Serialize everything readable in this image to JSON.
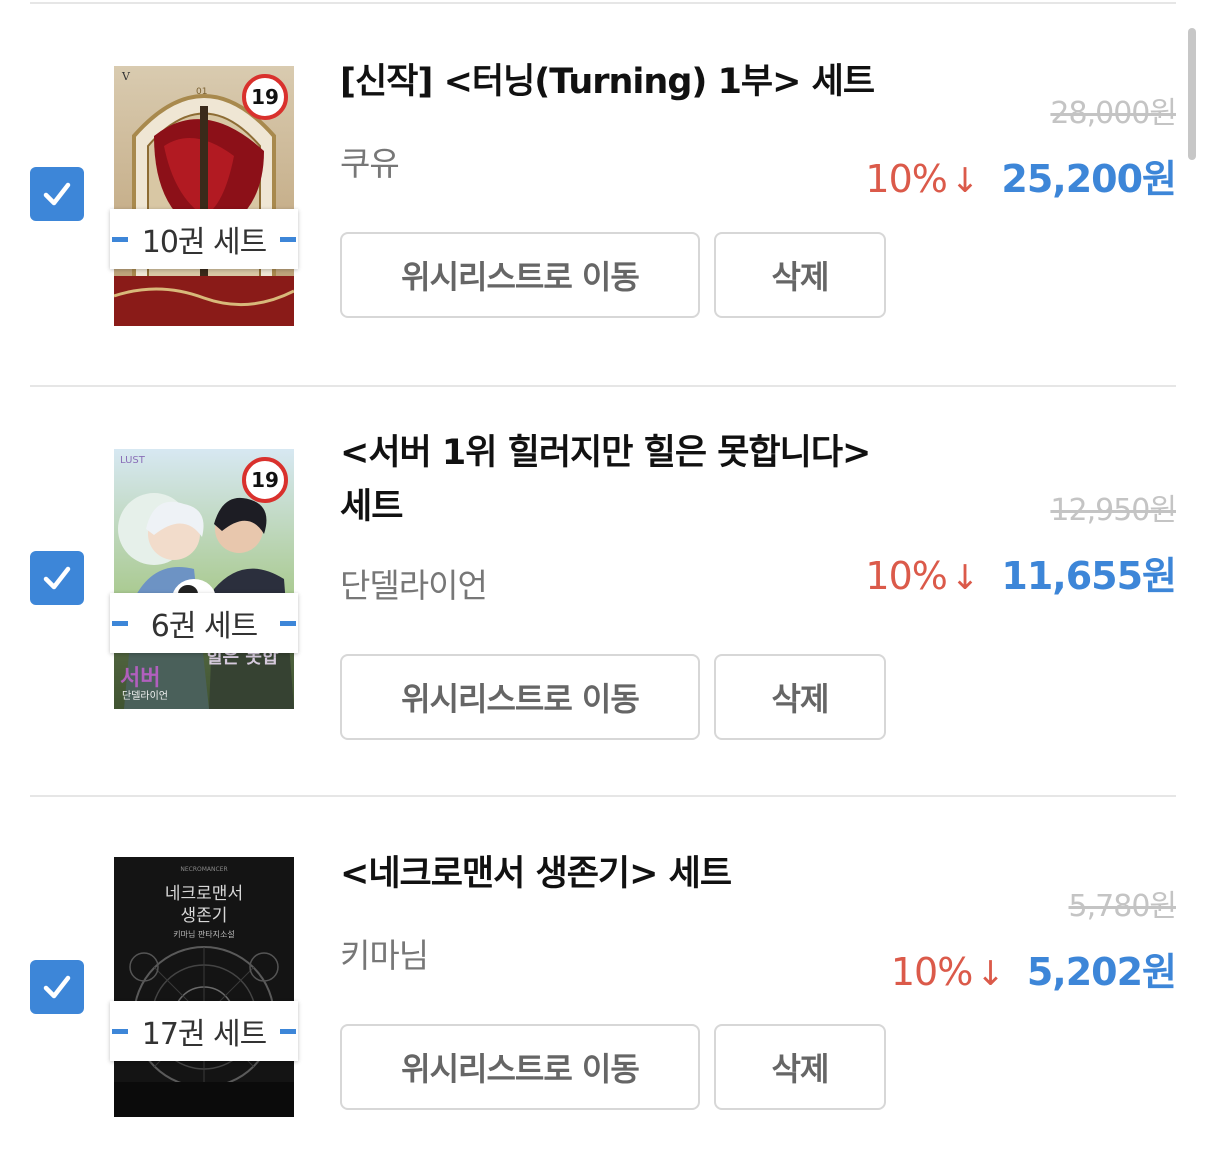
{
  "items": [
    {
      "checked": true,
      "title": "[신작] <터닝(Turning) 1부> 세트",
      "author": "쿠유",
      "set_label": "10권 세트",
      "age_badge": "19",
      "original_price": "28,000원",
      "discount": "10%",
      "discount_arrow": "↓",
      "sale_price": "25,200원",
      "wishlist_button": "위시리스트로 이동",
      "delete_button": "삭제"
    },
    {
      "checked": true,
      "title": "<서버 1위 힐러지만 힐은 못합니다> 세트",
      "author": "단델라이언",
      "set_label": "6권 세트",
      "age_badge": "19",
      "original_price": "12,950원",
      "discount": "10%",
      "discount_arrow": "↓",
      "sale_price": "11,655원",
      "wishlist_button": "위시리스트로 이동",
      "delete_button": "삭제"
    },
    {
      "checked": true,
      "title": "<네크로맨서 생존기> 세트",
      "author": "키마님",
      "set_label": "17권 세트",
      "original_price": "5,780원",
      "discount": "10%",
      "discount_arrow": "↓",
      "sale_price": "5,202원",
      "wishlist_button": "위시리스트로 이동",
      "delete_button": "삭제"
    }
  ],
  "colors": {
    "accent_blue": "#3d86d8",
    "discount_red": "#db5a4a",
    "age_badge_red": "#d9312d"
  }
}
